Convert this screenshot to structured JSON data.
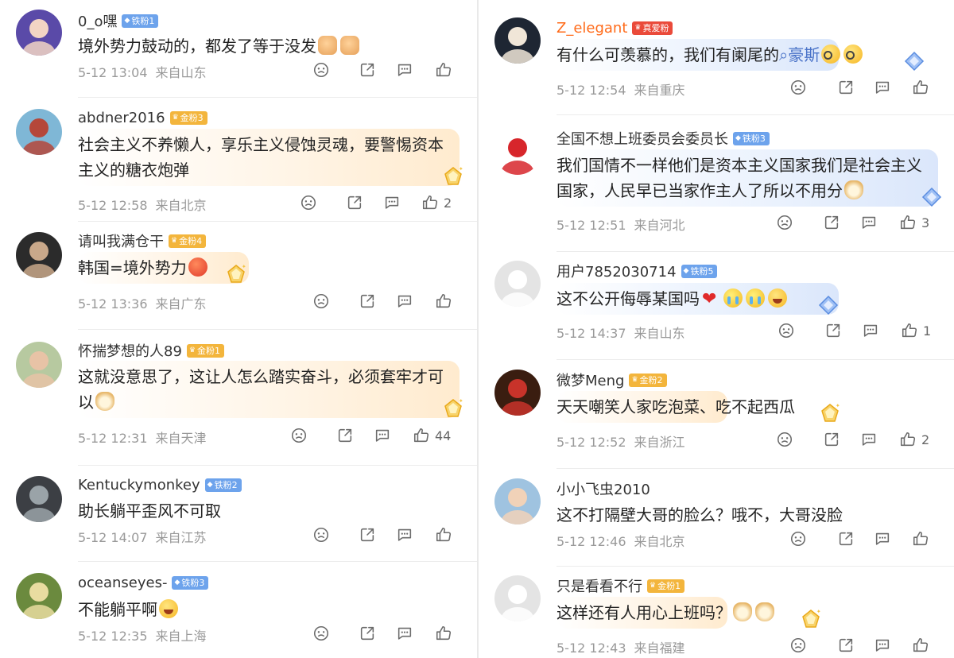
{
  "left": [
    {
      "user": "0_o嘿",
      "badge": "铁粉1",
      "badge_type": "tie",
      "text": "境外势力鼓动的，都发了等于没发",
      "emojis": [
        "thumbdown",
        "thumbdown"
      ],
      "time": "5-12 13:04",
      "location": "来自山东",
      "likes": "",
      "avatar": {
        "bg": "#5a4aa8",
        "fg": "#f2d5c4"
      },
      "gem": false
    },
    {
      "user": "abdner2016",
      "badge": "金粉3",
      "badge_type": "jin",
      "text": "社会主义不养懒人，享乐主义侵蚀灵魂，要警惕资本主义的糖衣炮弹",
      "emojis": [],
      "time": "5-12 12:58",
      "location": "来自北京",
      "likes": "2",
      "avatar": {
        "bg": "#7fb7d6",
        "fg": "#b5473a"
      },
      "gem": true
    },
    {
      "user": "请叫我满仓干",
      "badge": "金粉4",
      "badge_type": "jin",
      "text": "韩国=境外势力",
      "emojis": [
        "angry"
      ],
      "time": "5-12 13:36",
      "location": "来自广东",
      "likes": "",
      "avatar": {
        "bg": "#2b2b2b",
        "fg": "#c9a88a"
      },
      "gem": true
    },
    {
      "user": "怀揣梦想的人89",
      "badge": "金粉1",
      "badge_type": "jin",
      "text": "这就没意思了，这让人怎么踏实奋斗，必须套牢才可以",
      "emojis": [
        "dog"
      ],
      "time": "5-12 12:31",
      "location": "来自天津",
      "likes": "44",
      "avatar": {
        "bg": "#b7c9a0",
        "fg": "#e8c3a6"
      },
      "gem": true
    },
    {
      "user": "Kentuckymonkey",
      "badge": "铁粉2",
      "badge_type": "tie",
      "text": "助长躺平歪风不可取",
      "emojis": [],
      "time": "5-12 14:07",
      "location": "来自江苏",
      "likes": "",
      "avatar": {
        "bg": "#3c3f44",
        "fg": "#9aa3a8"
      },
      "gem": false
    },
    {
      "user": "oceanseyes-",
      "badge": "铁粉3",
      "badge_type": "tie",
      "text": "不能躺平啊",
      "emojis": [
        "lol"
      ],
      "time": "5-12 12:35",
      "location": "来自上海",
      "likes": "",
      "avatar": {
        "bg": "#6b8a3e",
        "fg": "#e9dca0"
      },
      "gem": false
    }
  ],
  "right": [
    {
      "user": "Z_elegant",
      "badge": "真爱粉",
      "badge_type": "zhen",
      "hot": true,
      "text": "有什么可羡慕的，我们有阑尾的",
      "link": "豪斯",
      "emojis": [
        "glasses",
        "glasses"
      ],
      "time": "5-12 12:54",
      "location": "来自重庆",
      "likes": "",
      "avatar": {
        "bg": "#1e2633",
        "fg": "#f0e6d8"
      },
      "gem": true,
      "bubble": "blue"
    },
    {
      "user": "全国不想上班委员会委员长",
      "badge": "铁粉3",
      "badge_type": "tie",
      "text": "我们国情不一样他们是资本主义国家我们是社会主义国家，人民早已当家作主人了所以不用分",
      "emojis": [
        "dog"
      ],
      "time": "5-12 12:51",
      "location": "来自河北",
      "likes": "3",
      "avatar": {
        "bg": "#ffffff",
        "fg": "#d7262b"
      },
      "gem": true,
      "bubble": "blue"
    },
    {
      "user": "用户7852030714",
      "badge": "铁粉5",
      "badge_type": "tie",
      "text": "这不公开侮辱某国吗",
      "emojis": [
        "heart",
        "cry",
        "cry",
        "lol"
      ],
      "time": "5-12 14:37",
      "location": "来自山东",
      "likes": "1",
      "avatar": {
        "bg": "#e4e4e4",
        "fg": "#ffffff"
      },
      "gem": true,
      "bubble": "blue"
    },
    {
      "user": "微梦Meng",
      "badge": "金粉2",
      "badge_type": "jin",
      "text": "天天嘲笑人家吃泡菜、吃不起西瓜",
      "emojis": [],
      "time": "5-12 12:52",
      "location": "来自浙江",
      "likes": "2",
      "avatar": {
        "bg": "#3a1d10",
        "fg": "#c8332a"
      },
      "gem": true,
      "bubble": "gold"
    },
    {
      "user": "小小飞虫2010",
      "badge": "",
      "badge_type": "",
      "text": "这不打隔壁大哥的脸么？哦不，大哥没脸",
      "emojis": [],
      "time": "5-12 12:46",
      "location": "来自北京",
      "likes": "",
      "avatar": {
        "bg": "#9fc3e0",
        "fg": "#f1d2b8"
      },
      "gem": false
    },
    {
      "user": "只是看看不行",
      "badge": "金粉1",
      "badge_type": "jin",
      "text": "这样还有人用心上班吗？",
      "emojis": [
        "dog",
        "dog"
      ],
      "time": "5-12 12:43",
      "location": "来自福建",
      "likes": "",
      "avatar": {
        "bg": "#e4e4e4",
        "fg": "#ffffff"
      },
      "gem": true,
      "bubble": "gold"
    }
  ]
}
